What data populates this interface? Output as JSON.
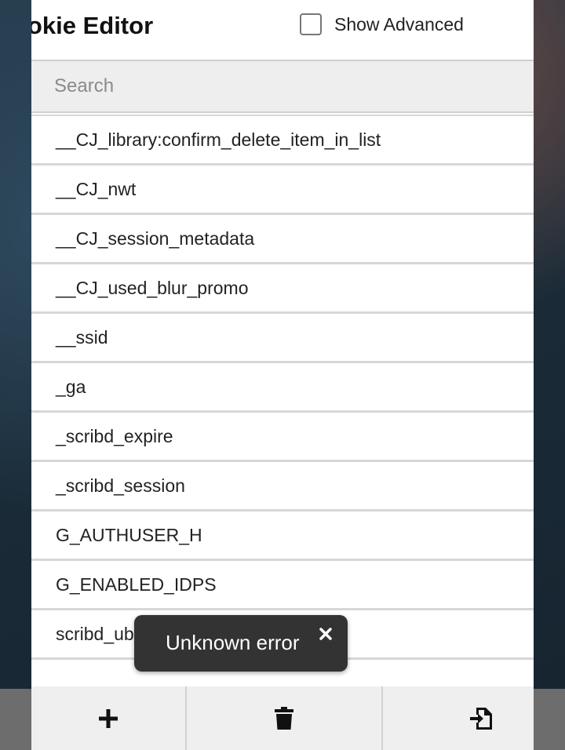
{
  "header": {
    "title": "ookie Editor",
    "show_advanced_label": "Show Advanced",
    "show_advanced_checked": false
  },
  "search": {
    "placeholder": "Search",
    "value": ""
  },
  "cookies": [
    "__CJ_library:confirm_delete_item_in_list",
    "__CJ_nwt",
    "__CJ_session_metadata",
    "__CJ_used_blur_promo",
    "__ssid",
    "_ga",
    "_scribd_expire",
    "_scribd_session",
    "G_AUTHUSER_H",
    "G_ENABLED_IDPS",
    "scribd_ubtc"
  ],
  "toast": {
    "message": "Unknown error",
    "close_icon": "close-icon"
  },
  "footer": {
    "add_icon": "plus-icon",
    "delete_icon": "trash-icon",
    "import_icon": "import-file-icon"
  },
  "colors": {
    "toast_bg": "#333333",
    "footer_bg": "#efefef",
    "search_bg": "#eeeeee"
  }
}
